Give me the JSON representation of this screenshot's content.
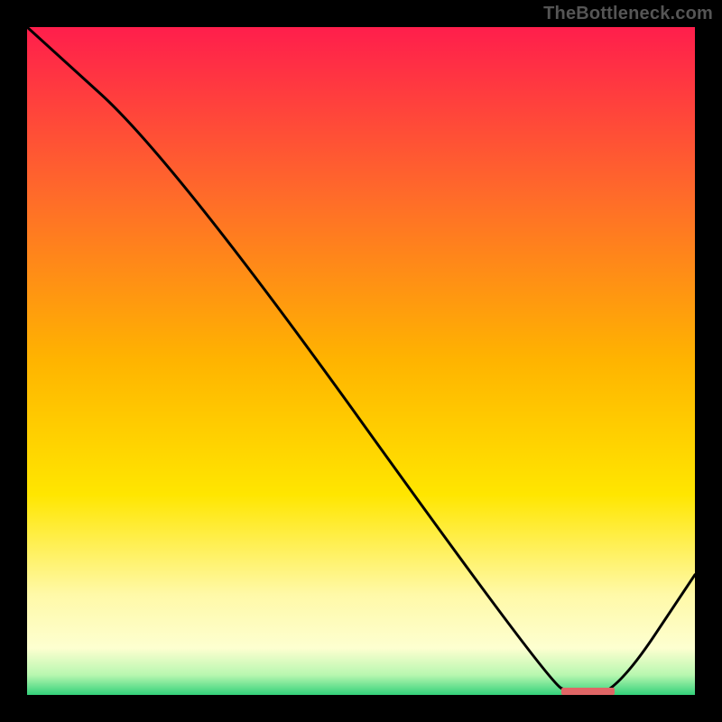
{
  "watermark": "TheBottleneck.com",
  "colors": {
    "background": "#000000",
    "line": "#000000",
    "marker": "#e06666",
    "gradient_stops": [
      {
        "offset": 0.0,
        "color": "#ff1e4c"
      },
      {
        "offset": 0.25,
        "color": "#ff6a2a"
      },
      {
        "offset": 0.5,
        "color": "#ffb400"
      },
      {
        "offset": 0.7,
        "color": "#ffe600"
      },
      {
        "offset": 0.85,
        "color": "#fff9a8"
      },
      {
        "offset": 0.93,
        "color": "#fdffd0"
      },
      {
        "offset": 0.97,
        "color": "#b8f7b0"
      },
      {
        "offset": 1.0,
        "color": "#33d17a"
      }
    ]
  },
  "chart_data": {
    "type": "line",
    "title": "",
    "xlabel": "",
    "ylabel": "",
    "xlim": [
      0,
      100
    ],
    "ylim": [
      0,
      100
    ],
    "x": [
      0,
      22,
      78,
      82,
      88,
      100
    ],
    "values": [
      100,
      80,
      2,
      0,
      0,
      18
    ],
    "marker": {
      "x_start": 80,
      "x_end": 88,
      "y": 0
    }
  }
}
